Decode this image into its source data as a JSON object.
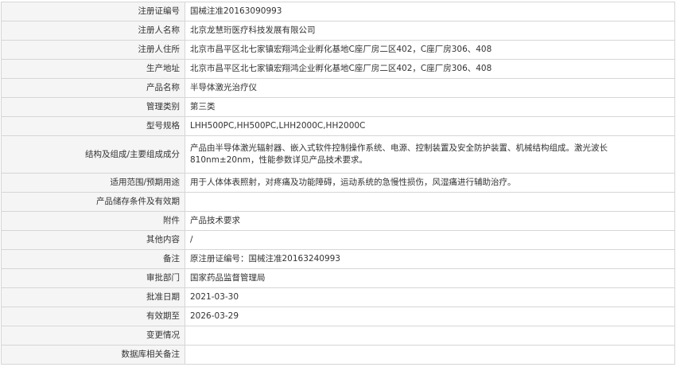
{
  "rows": [
    {
      "label": "注册证编号",
      "value": "国械注准20163090993"
    },
    {
      "label": "注册人名称",
      "value": "北京龙慧珩医疗科技发展有限公司"
    },
    {
      "label": "注册人住所",
      "value": "北京市昌平区北七家镇宏翔鸿企业孵化基地C座厂房二区402，C座厂房306、408"
    },
    {
      "label": "生产地址",
      "value": "北京市昌平区北七家镇宏翔鸿企业孵化基地C座厂房二区402，C座厂房306、408"
    },
    {
      "label": "产品名称",
      "value": "半导体激光治疗仪"
    },
    {
      "label": "管理类别",
      "value": "第三类"
    },
    {
      "label": "型号规格",
      "value": "LHH500PC,HH500PC,LHH2000C,HH2000C"
    },
    {
      "label": "结构及组成/主要组成成分",
      "value": "产品由半导体激光辐射器、嵌入式软件控制操作系统、电源、控制装置及安全防护装置、机械结构组成。激光波长810nm±20nm，性能参数详见产品技术要求。"
    },
    {
      "label": "适用范围/预期用途",
      "value": "用于人体体表照射，对疼痛及功能障碍，运动系统的急慢性损伤，风湿痛进行辅助治疗。"
    },
    {
      "label": "产品储存条件及有效期",
      "value": ""
    },
    {
      "label": "附件",
      "value": "产品技术要求"
    },
    {
      "label": "其他内容",
      "value": "/"
    },
    {
      "label": "备注",
      "value": "原注册证编号：国械注准20163240993"
    },
    {
      "label": "审批部门",
      "value": "国家药品监督管理局"
    },
    {
      "label": "批准日期",
      "value": "2021-03-30"
    },
    {
      "label": "有效期至",
      "value": "2026-03-29"
    },
    {
      "label": "变更情况",
      "value": ""
    },
    {
      "label": "数据库相关备注",
      "value": ""
    }
  ]
}
